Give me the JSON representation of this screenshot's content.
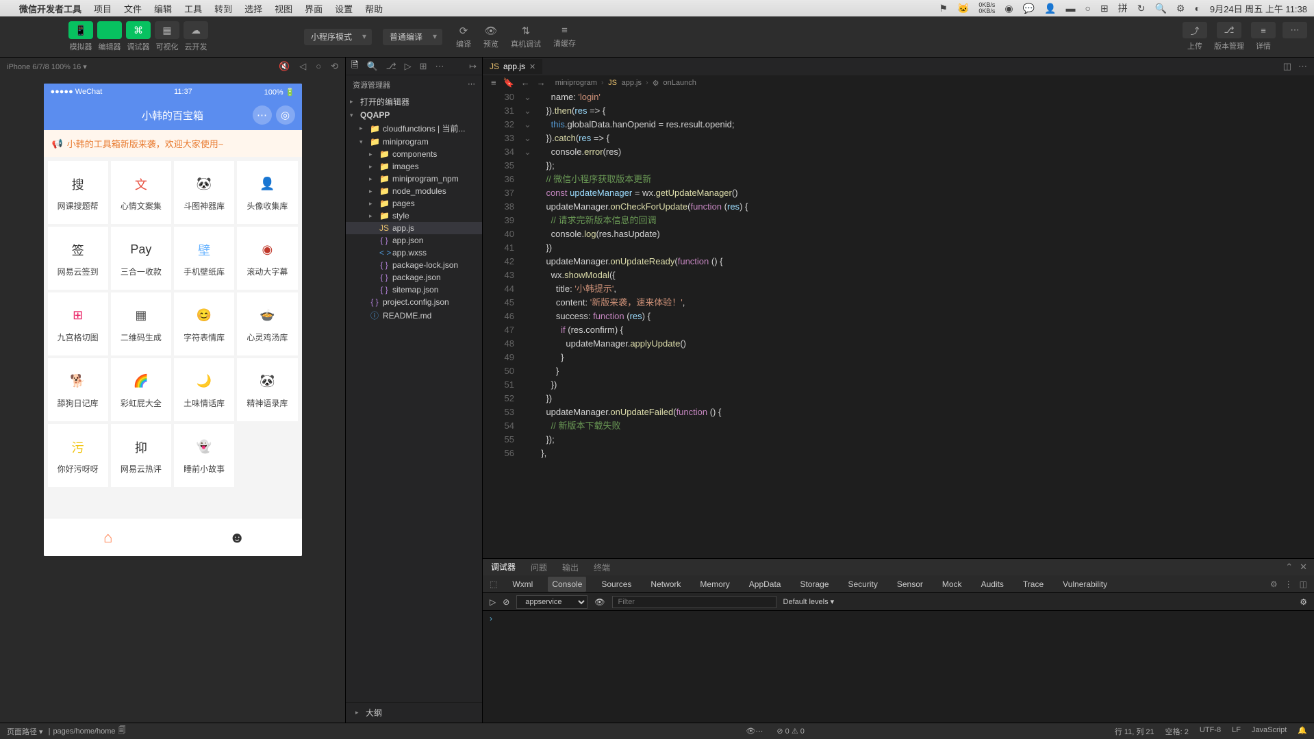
{
  "menubar": {
    "app": "微信开发者工具",
    "items": [
      "项目",
      "文件",
      "编辑",
      "工具",
      "转到",
      "选择",
      "视图",
      "界面",
      "设置",
      "帮助"
    ],
    "net_up": "0KB/s",
    "net_down": "0KB/s",
    "datetime": "9月24日 周五 上午 11:38"
  },
  "toolbar": {
    "buttons": [
      {
        "icon": "📱",
        "label": "模拟器"
      },
      {
        "icon": "</>",
        "label": "编辑器"
      },
      {
        "icon": "⌘",
        "label": "调试器"
      },
      {
        "icon": "▦",
        "label": "可视化"
      },
      {
        "icon": "☁",
        "label": "云开发"
      }
    ],
    "mode": {
      "value": "小程序模式"
    },
    "compile": {
      "value": "普通编译"
    },
    "mid": [
      {
        "icon": "⟳",
        "label": "编译"
      },
      {
        "icon": "👁",
        "label": "预览"
      },
      {
        "icon": "⇅",
        "label": "真机调试"
      },
      {
        "icon": "≡",
        "label": "清缓存"
      }
    ],
    "right": [
      {
        "icon": "⤴",
        "label": "上传"
      },
      {
        "icon": "⎇",
        "label": "版本管理"
      },
      {
        "icon": "≡",
        "label": "详情"
      },
      {
        "icon": "⋯",
        "label": ""
      }
    ]
  },
  "sim": {
    "device": "iPhone 6/7/8 100% 16 ▾",
    "phone": {
      "carrier": "●●●●● WeChat",
      "time": "11:37",
      "battery": "100%",
      "title": "小韩的百宝箱",
      "banner": "小韩的工具箱新版来袭，欢迎大家使用~",
      "grid": [
        [
          {
            "ic": "搜",
            "lbl": "网课搜题帮",
            "c": "#333"
          },
          {
            "ic": "文",
            "lbl": "心情文案集",
            "c": "#e74c3c"
          },
          {
            "ic": "🐼",
            "lbl": "斗图神器库",
            "c": ""
          },
          {
            "ic": "👤",
            "lbl": "头像收集库",
            "c": "#8b4513"
          }
        ],
        [
          {
            "ic": "签",
            "lbl": "网易云签到",
            "c": "#333"
          },
          {
            "ic": "Pay",
            "lbl": "三合一收款",
            "c": "#333"
          },
          {
            "ic": "壁",
            "lbl": "手机壁纸库",
            "c": "#6bb5ff"
          },
          {
            "ic": "◉",
            "lbl": "滚动大字幕",
            "c": "#c0392b"
          }
        ],
        [
          {
            "ic": "⊞",
            "lbl": "九宫格切图",
            "c": "#e91e63"
          },
          {
            "ic": "▦",
            "lbl": "二维码生成",
            "c": "#555"
          },
          {
            "ic": "😊",
            "lbl": "字符表情库",
            "c": "#9b59b6"
          },
          {
            "ic": "🍲",
            "lbl": "心灵鸡汤库",
            "c": ""
          }
        ],
        [
          {
            "ic": "🐕",
            "lbl": "舔狗日记库",
            "c": ""
          },
          {
            "ic": "🌈",
            "lbl": "彩虹屁大全",
            "c": ""
          },
          {
            "ic": "🌙",
            "lbl": "土味情话库",
            "c": ""
          },
          {
            "ic": "🐼",
            "lbl": "精神语录库",
            "c": ""
          }
        ],
        [
          {
            "ic": "污",
            "lbl": "你好污呀呀",
            "c": "#f1c40f"
          },
          {
            "ic": "抑",
            "lbl": "网易云热评",
            "c": "#333"
          },
          {
            "ic": "👻",
            "lbl": "睡前小故事",
            "c": "#bbb"
          },
          {
            "ic": "",
            "lbl": "",
            "c": ""
          }
        ]
      ]
    }
  },
  "explorer": {
    "title": "资源管理器",
    "sections": {
      "opened": "打开的编辑器",
      "project": "QQAPP",
      "outline": "大纲"
    },
    "tree": [
      {
        "depth": 1,
        "arrow": "▸",
        "ic": "folder",
        "name": "cloudfunctions | 当前..."
      },
      {
        "depth": 1,
        "arrow": "▾",
        "ic": "folder",
        "name": "miniprogram"
      },
      {
        "depth": 2,
        "arrow": "▸",
        "ic": "folder",
        "name": "components"
      },
      {
        "depth": 2,
        "arrow": "▸",
        "ic": "folder",
        "name": "images"
      },
      {
        "depth": 2,
        "arrow": "▸",
        "ic": "folder",
        "name": "miniprogram_npm"
      },
      {
        "depth": 2,
        "arrow": "▸",
        "ic": "folder",
        "name": "node_modules"
      },
      {
        "depth": 2,
        "arrow": "▸",
        "ic": "folder",
        "name": "pages"
      },
      {
        "depth": 2,
        "arrow": "▸",
        "ic": "folder",
        "name": "style"
      },
      {
        "depth": 2,
        "arrow": "",
        "ic": "js",
        "name": "app.js",
        "active": true
      },
      {
        "depth": 2,
        "arrow": "",
        "ic": "json",
        "name": "app.json"
      },
      {
        "depth": 2,
        "arrow": "",
        "ic": "wxss",
        "name": "app.wxss"
      },
      {
        "depth": 2,
        "arrow": "",
        "ic": "json",
        "name": "package-lock.json"
      },
      {
        "depth": 2,
        "arrow": "",
        "ic": "json",
        "name": "package.json"
      },
      {
        "depth": 2,
        "arrow": "",
        "ic": "json",
        "name": "sitemap.json"
      },
      {
        "depth": 1,
        "arrow": "",
        "ic": "json",
        "name": "project.config.json"
      },
      {
        "depth": 1,
        "arrow": "",
        "ic": "md",
        "name": "README.md"
      }
    ]
  },
  "editor": {
    "tab": {
      "name": "app.js"
    },
    "breadcrumb": [
      "miniprogram",
      "app.js",
      "onLaunch"
    ],
    "lines": [
      {
        "n": 30,
        "html": "      name: <span class='tok-str'>'login'</span>"
      },
      {
        "n": 31,
        "html": "    }).<span class='tok-fn'>then</span>(<span class='tok-id'>res</span> <span class='tok-op'>=&gt;</span> {"
      },
      {
        "n": 32,
        "html": "      <span class='tok-this'>this</span>.globalData.hanOpenid = res.result.openid;"
      },
      {
        "n": 33,
        "html": "    }).<span class='tok-fn'>catch</span>(<span class='tok-id'>res</span> <span class='tok-op'>=&gt;</span> {"
      },
      {
        "n": 34,
        "html": "      console.<span class='tok-fn'>error</span>(res)"
      },
      {
        "n": 35,
        "html": "    });"
      },
      {
        "n": 36,
        "html": "    <span class='tok-cm'>// 微信小程序获取版本更新</span>"
      },
      {
        "n": 37,
        "html": "    <span class='tok-kw'>const</span> <span class='tok-id'>updateManager</span> = wx.<span class='tok-fn'>getUpdateManager</span>()"
      },
      {
        "n": 38,
        "html": "    updateManager.<span class='tok-fn'>onCheckForUpdate</span>(<span class='tok-kw'>function</span> (<span class='tok-id'>res</span>) {"
      },
      {
        "n": 39,
        "html": "      <span class='tok-cm'>// 请求完新版本信息的回调</span>"
      },
      {
        "n": 40,
        "html": "      console.<span class='tok-fn'>log</span>(res.hasUpdate)"
      },
      {
        "n": 41,
        "html": "    })"
      },
      {
        "n": 42,
        "html": "    updateManager.<span class='tok-fn'>onUpdateReady</span>(<span class='tok-kw'>function</span> () {"
      },
      {
        "n": 43,
        "html": "      wx.<span class='tok-fn'>showModal</span>({"
      },
      {
        "n": 44,
        "html": "        title: <span class='tok-str'>'小韩提示'</span>,"
      },
      {
        "n": 45,
        "html": "        content: <span class='tok-str'>'新版来袭，速来体验！'</span>,"
      },
      {
        "n": 46,
        "html": "        success: <span class='tok-kw'>function</span> (<span class='tok-id'>res</span>) {"
      },
      {
        "n": 47,
        "html": "          <span class='tok-kw'>if</span> (res.confirm) {"
      },
      {
        "n": 48,
        "html": "            updateManager.<span class='tok-fn'>applyUpdate</span>()"
      },
      {
        "n": 49,
        "html": "          }"
      },
      {
        "n": 50,
        "html": "        }"
      },
      {
        "n": 51,
        "html": "      })"
      },
      {
        "n": 52,
        "html": "    })"
      },
      {
        "n": 53,
        "html": "    updateManager.<span class='tok-fn'>onUpdateFailed</span>(<span class='tok-kw'>function</span> () {"
      },
      {
        "n": 54,
        "html": "      <span class='tok-cm'>// 新版本下载失败</span>"
      },
      {
        "n": 55,
        "html": "    });"
      },
      {
        "n": 56,
        "html": "  },"
      }
    ]
  },
  "debugger": {
    "top_tabs": [
      "调试器",
      "问题",
      "输出",
      "终端"
    ],
    "top_active": "调试器",
    "dev_tabs": [
      "Wxml",
      "Console",
      "Sources",
      "Network",
      "Memory",
      "AppData",
      "Storage",
      "Security",
      "Sensor",
      "Mock",
      "Audits",
      "Trace",
      "Vulnerability"
    ],
    "dev_active": "Console",
    "context": "appservice",
    "filter_placeholder": "Filter",
    "levels": "Default levels ▾",
    "prompt": "›"
  },
  "statusbar": {
    "left_label": "页面路径 ▾",
    "page_path": "pages/home/home",
    "warnings": "⊘ 0 ⚠ 0",
    "right": {
      "cursor": "行 11, 列 21",
      "spaces": "空格: 2",
      "encoding": "UTF-8",
      "eol": "LF",
      "lang": "JavaScript",
      "bell": "🔔"
    }
  }
}
